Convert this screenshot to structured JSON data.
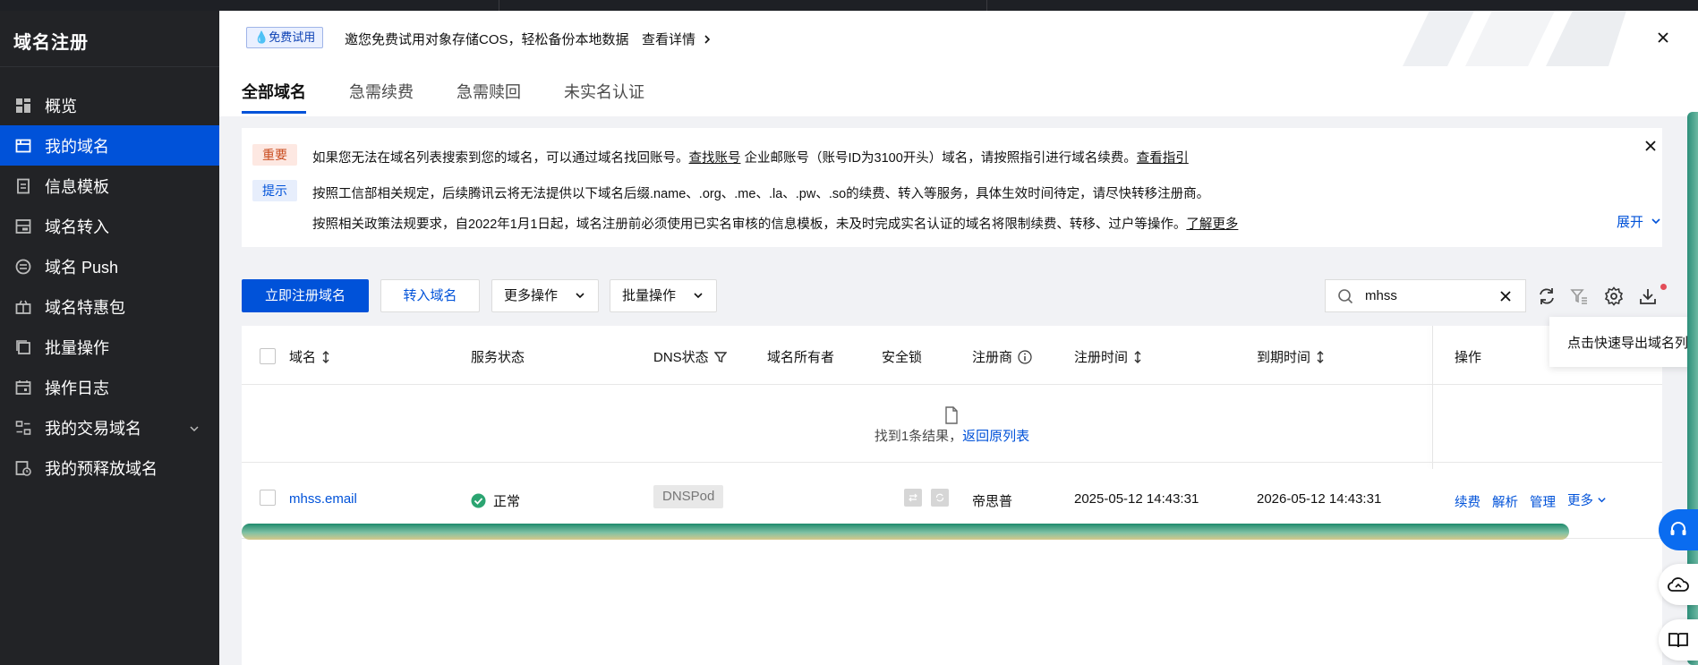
{
  "sidebar": {
    "title": "域名注册",
    "items": [
      {
        "label": "概览",
        "icon": "dashboard-icon",
        "active": false
      },
      {
        "label": "我的域名",
        "icon": "domain-icon",
        "active": true
      },
      {
        "label": "信息模板",
        "icon": "template-icon",
        "active": false
      },
      {
        "label": "域名转入",
        "icon": "transfer-in-icon",
        "active": false
      },
      {
        "label": "域名 Push",
        "icon": "push-icon",
        "active": false
      },
      {
        "label": "域名特惠包",
        "icon": "gift-icon",
        "active": false
      },
      {
        "label": "批量操作",
        "icon": "batch-icon",
        "active": false
      },
      {
        "label": "操作日志",
        "icon": "calendar-icon",
        "active": false
      },
      {
        "label": "我的交易域名",
        "icon": "trade-icon",
        "active": false,
        "has_submenu": true
      },
      {
        "label": "我的预释放域名",
        "icon": "pre-release-icon",
        "active": false
      }
    ]
  },
  "promo": {
    "badge": "免费试用",
    "text": "邀您免费试用对象存储COS，轻松备份本地数据",
    "link": "查看详情"
  },
  "tabs": [
    {
      "label": "全部域名",
      "active": true
    },
    {
      "label": "急需续费",
      "active": false
    },
    {
      "label": "急需赎回",
      "active": false
    },
    {
      "label": "未实名认证",
      "active": false
    }
  ],
  "notice": {
    "important_tag": "重要",
    "important_text_1": "如果您无法在域名列表搜索到您的域名，可以通过域名找回账号。",
    "important_link_1": "查找账号",
    "important_text_2": " 企业邮账号（账号ID为3100开头）域名，请按照指引进行域名续费。",
    "important_link_2": "查看指引",
    "tip_tag": "提示",
    "tip_text_1": "按照工信部相关规定，后续腾讯云将无法提供以下域名后缀.name、.org、.me、.la、.pw、.so的续费、转入等服务，具体生效时间待定，请尽快转移注册商。",
    "tip_text_2": "按照相关政策法规要求，自2022年1月1日起，域名注册前必须使用已实名审核的信息模板，未及时完成实名认证的域名将限制续费、转移、过户等操作。",
    "tip_link": "了解更多",
    "expand": "展开"
  },
  "toolbar": {
    "register": "立即注册域名",
    "transfer": "转入域名",
    "more_ops": "更多操作",
    "batch_ops": "批量操作",
    "search_value": "mhss",
    "export_tooltip": "点击快速导出域名列表"
  },
  "table": {
    "headers": {
      "domain": "域名",
      "service_status": "服务状态",
      "dns_status": "DNS状态",
      "owner": "域名所有者",
      "security_lock": "安全锁",
      "registrar": "注册商",
      "reg_time": "注册时间",
      "expire_time": "到期时间",
      "actions": "操作"
    },
    "result_text": "找到1条结果，",
    "result_back": "返回原列表",
    "rows": [
      {
        "domain": "mhss.email",
        "status": "正常",
        "dns": "DNSPod",
        "owner": "",
        "registrar": "帝思普",
        "reg_time": "2025-05-12 14:43:31",
        "expire_time": "2026-05-12 14:43:31",
        "actions": [
          "续费",
          "解析",
          "管理",
          "更多"
        ]
      }
    ]
  },
  "colors": {
    "primary": "#0052d9",
    "sidebar_bg": "#222326",
    "success": "#2ba471",
    "danger": "#e34d59"
  }
}
